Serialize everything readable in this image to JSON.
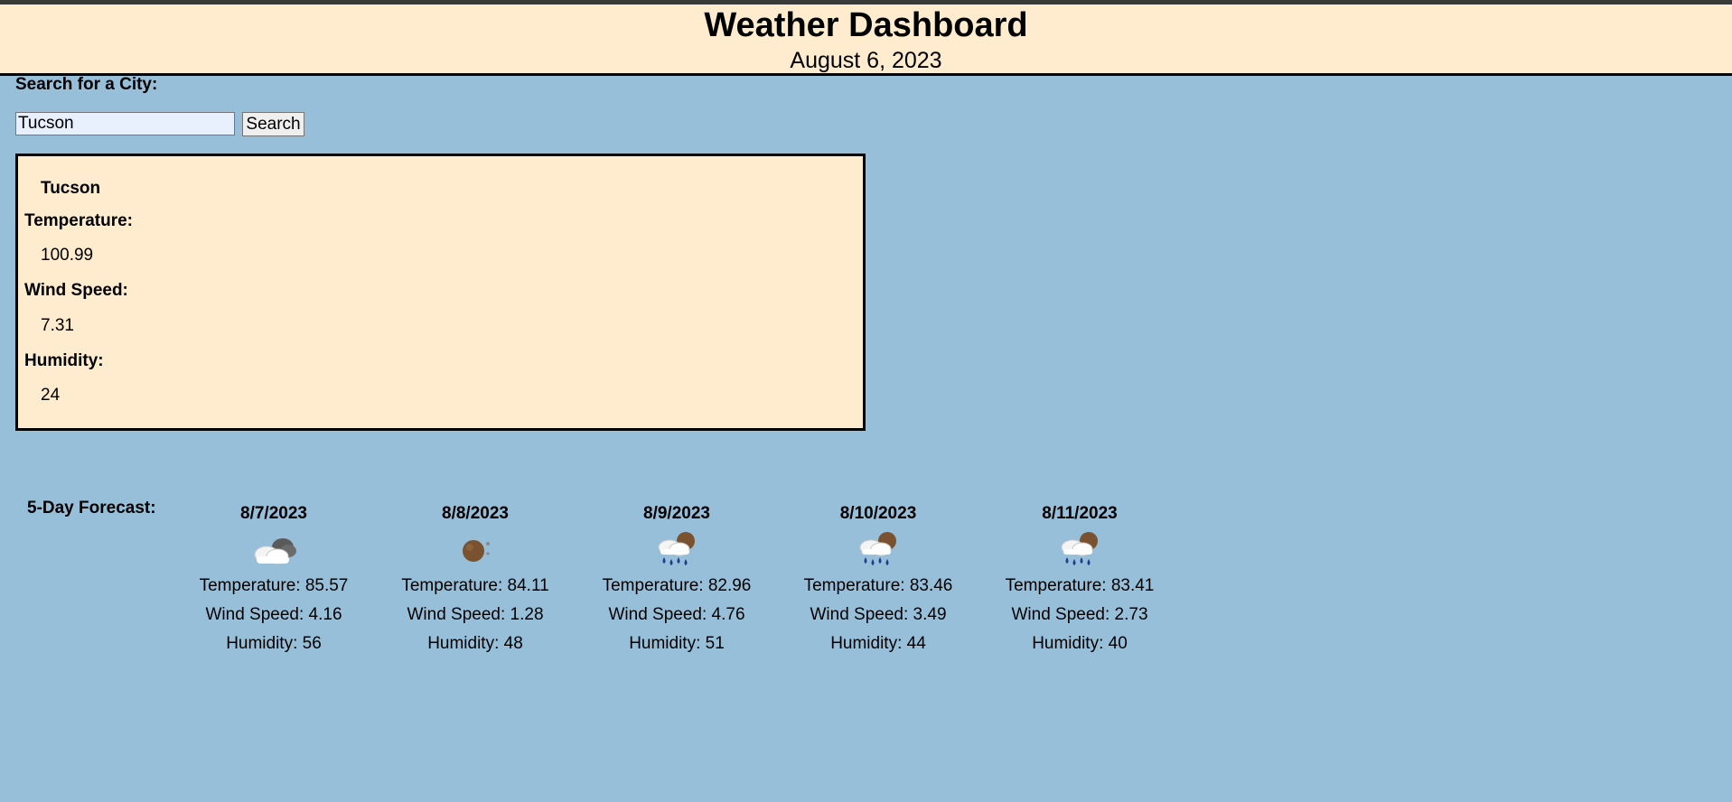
{
  "header": {
    "title": "Weather Dashboard",
    "date": "August 6, 2023"
  },
  "search": {
    "label": "Search for a City:",
    "value": "Tucson",
    "button_label": "Search"
  },
  "current": {
    "city": "Tucson",
    "temperature_label": "Temperature:",
    "temperature_value": "100.99",
    "wind_label": "Wind Speed:",
    "wind_value": "7.31",
    "humidity_label": "Humidity:",
    "humidity_value": "24"
  },
  "forecast": {
    "label": "5-Day Forecast:",
    "days": [
      {
        "date": "8/7/2023",
        "icon": "partly-cloudy-icon",
        "temperature": "Temperature: 85.57",
        "wind": "Wind Speed: 4.16",
        "humidity": "Humidity: 56"
      },
      {
        "date": "8/8/2023",
        "icon": "clear-night-icon",
        "temperature": "Temperature: 84.11",
        "wind": "Wind Speed: 1.28",
        "humidity": "Humidity: 48"
      },
      {
        "date": "8/9/2023",
        "icon": "rain-icon",
        "temperature": "Temperature: 82.96",
        "wind": "Wind Speed: 4.76",
        "humidity": "Humidity: 51"
      },
      {
        "date": "8/10/2023",
        "icon": "rain-icon",
        "temperature": "Temperature: 83.46",
        "wind": "Wind Speed: 3.49",
        "humidity": "Humidity: 44"
      },
      {
        "date": "8/11/2023",
        "icon": "rain-icon",
        "temperature": "Temperature: 83.41",
        "wind": "Wind Speed: 2.73",
        "humidity": "Humidity: 40"
      }
    ]
  },
  "colors": {
    "page_background": "#98bfd9",
    "panel_background": "#ffebcd",
    "top_bar": "#3a3a3a"
  }
}
